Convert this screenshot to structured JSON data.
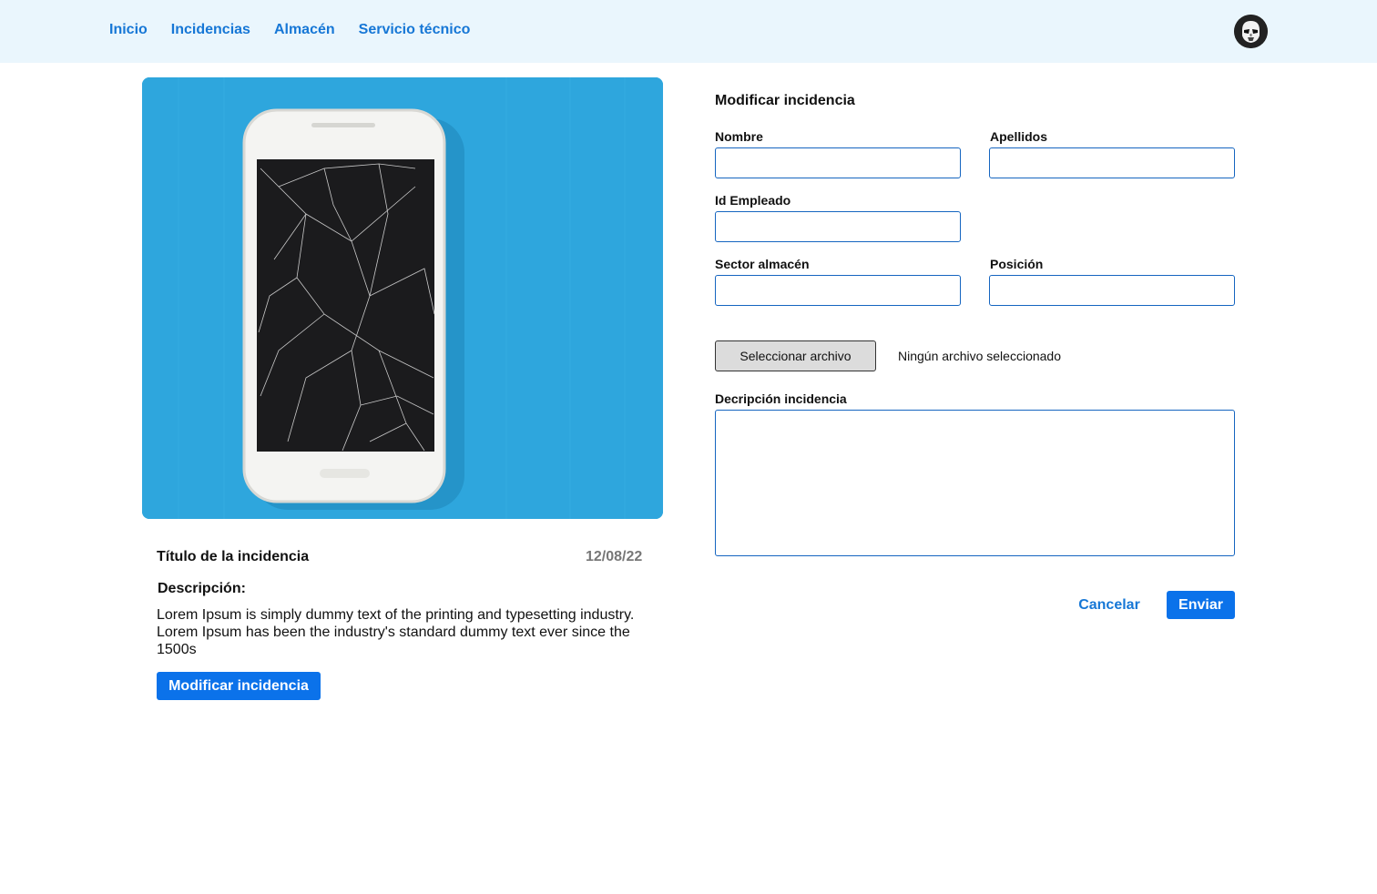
{
  "nav": {
    "items": [
      {
        "label": "Inicio"
      },
      {
        "label": "Incidencias"
      },
      {
        "label": "Almacén"
      },
      {
        "label": "Servicio técnico"
      }
    ],
    "avatar_icon": "user-avatar-icon"
  },
  "incident": {
    "image_icon": "broken-phone-image",
    "title": "Título de la incidencia",
    "date": "12/08/22",
    "description_label": "Descripción:",
    "description": "Lorem Ipsum is simply dummy text of the printing and typesetting industry. Lorem Ipsum has been the industry's standard dummy text ever since the 1500s",
    "modify_label": "Modificar incidencia"
  },
  "form": {
    "title": "Modificar incidencia",
    "fields": {
      "nombre": {
        "label": "Nombre",
        "value": ""
      },
      "apellidos": {
        "label": "Apellidos",
        "value": ""
      },
      "id_empleado": {
        "label": "Id Empleado",
        "value": ""
      },
      "sector": {
        "label": "Sector almacén",
        "value": ""
      },
      "posicion": {
        "label": "Posición",
        "value": ""
      }
    },
    "file_button_label": "Seleccionar archivo",
    "file_status": "Ningún archivo seleccionado",
    "description_label": "Decripción incidencia",
    "description_value": "",
    "cancel_label": "Cancelar",
    "submit_label": "Enviar"
  },
  "colors": {
    "accent": "#1677d6",
    "primary_button": "#0b72ea",
    "topbar_bg": "#eaf6fd",
    "photo_bg": "#2ea6dd"
  }
}
